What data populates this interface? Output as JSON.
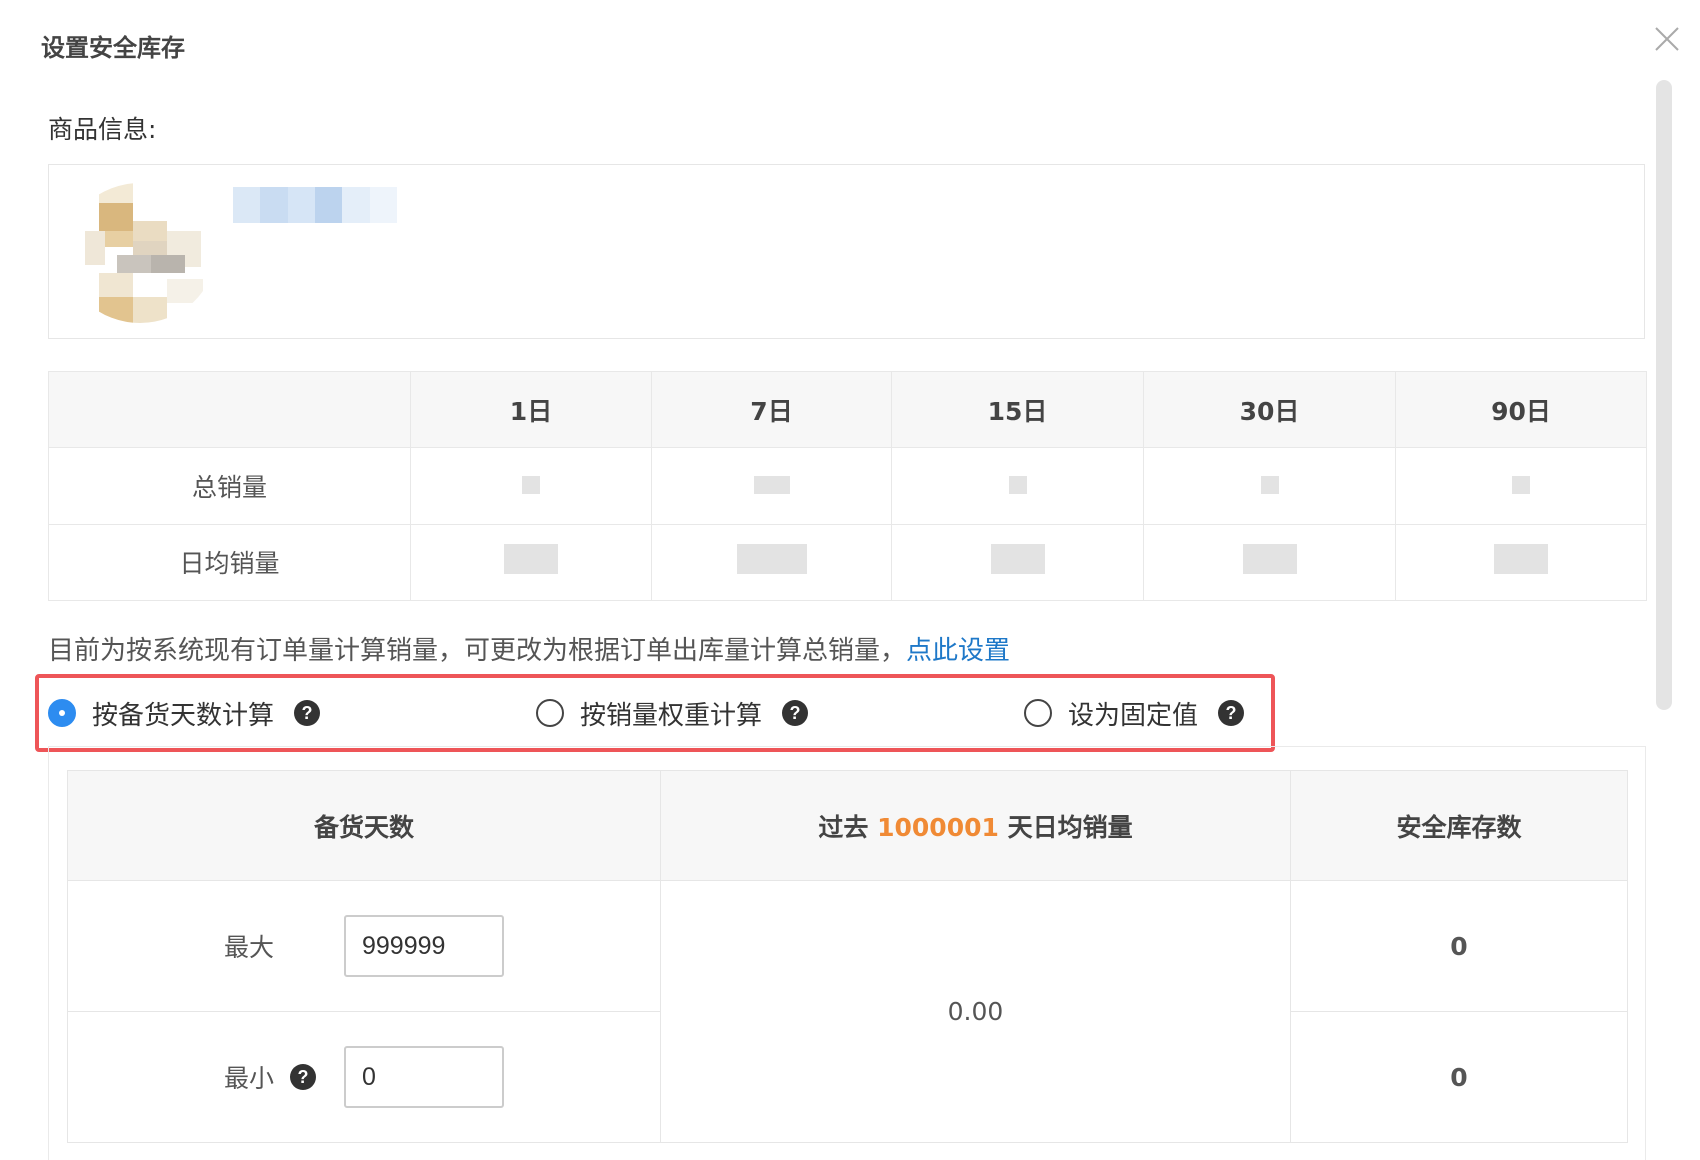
{
  "dialog": {
    "title": "设置安全库存"
  },
  "product_section": {
    "label": "商品信息:"
  },
  "sales_table": {
    "headers": [
      "",
      "1日",
      "7日",
      "15日",
      "30日",
      "90日"
    ],
    "rows": [
      {
        "label": "总销量"
      },
      {
        "label": "日均销量"
      }
    ]
  },
  "info_line": {
    "text": "目前为按系统现有订单量计算销量，可更改为根据订单出库量计算总销量，",
    "link": "点此设置"
  },
  "methods": {
    "options": [
      {
        "label": "按备货天数计算",
        "selected": true
      },
      {
        "label": "按销量权重计算",
        "selected": false
      },
      {
        "label": "设为固定值",
        "selected": false
      }
    ],
    "help_glyph": "?"
  },
  "calc_table": {
    "col1_header": "备货天数",
    "col2_header_prefix": "过去",
    "col2_header_days": "1000001",
    "col2_header_suffix": "天日均销量",
    "col3_header": "安全库存数",
    "max_label": "最大",
    "max_value": "999999",
    "min_label": "最小",
    "min_value": "0",
    "avg_sales": "0.00",
    "max_stock": "0",
    "min_stock": "0"
  },
  "colors": {
    "accent": "#2d8cf0",
    "link": "#1e78c8",
    "highlight": "#ee5558",
    "orange": "#f08a35"
  },
  "icons": {
    "close": "close-icon",
    "help": "help-circle-icon"
  }
}
